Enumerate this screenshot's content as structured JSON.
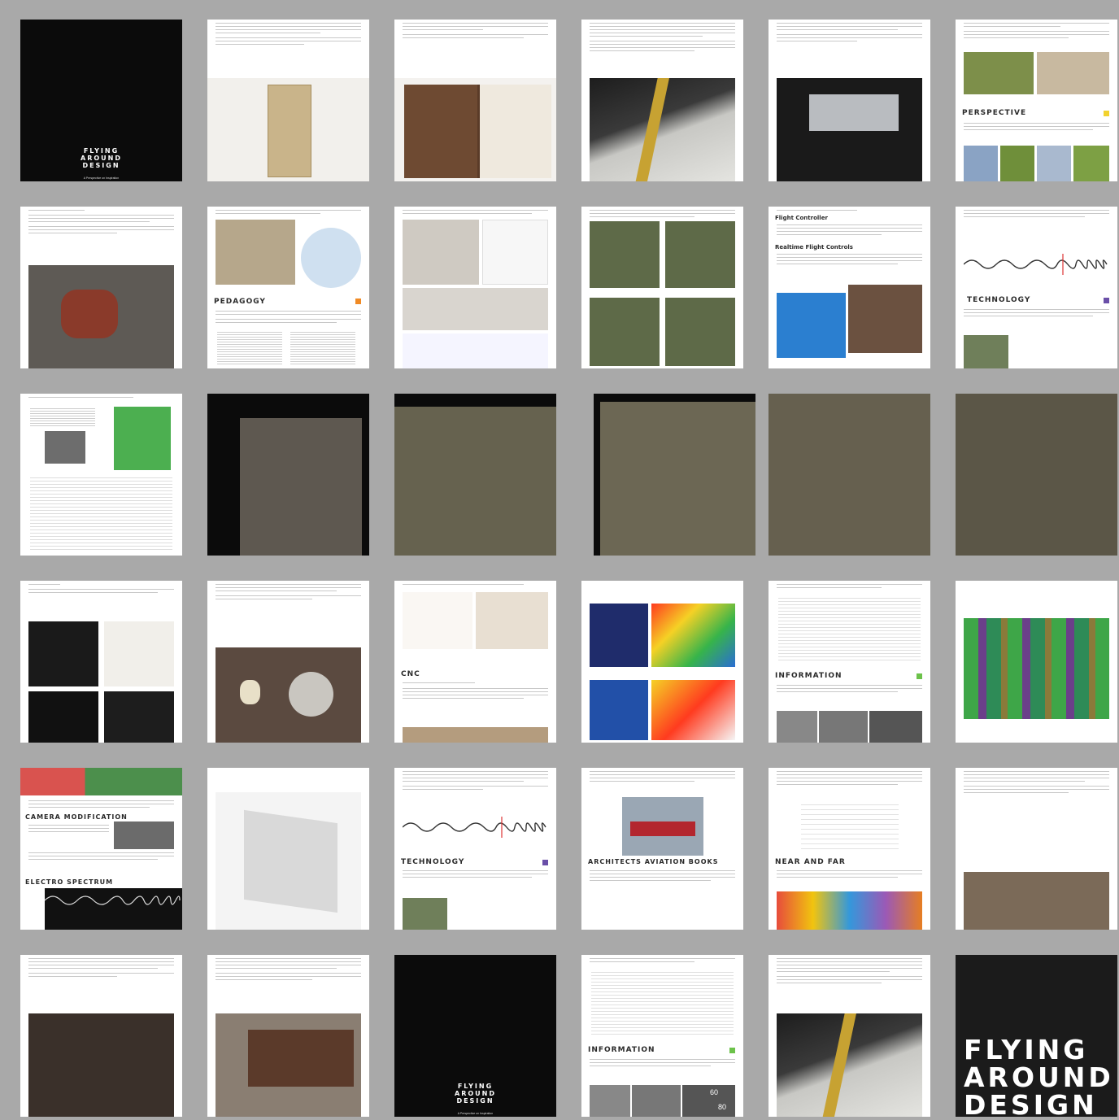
{
  "document": {
    "layout": "contact-sheet",
    "rows": 7,
    "columns": 6,
    "background": "#a9a9a9"
  },
  "cover": {
    "title_lines": [
      "FLYING",
      "AROUND",
      "DESIGN"
    ],
    "subtitle": "A Perspective on Inspiration"
  },
  "headings": {
    "perspective": "PERSPECTIVE",
    "pedagogy": "PEDAGOGY",
    "technology": "TECHNOLOGY",
    "flight_controller": "Flight Controller",
    "realtime_flight_controls": "Realtime Flight Controls",
    "cnc": "CNC",
    "information": "INFORMATION",
    "camera_modification": "CAMERA MODIFICATION",
    "electro_spectrum": "ELECTRO SPECTRUM",
    "architects_aviation_books": "ARCHITECTS AVIATION BOOKS",
    "near_and_far": "NEAR AND FAR"
  },
  "gauge_labels": {
    "primary": "60",
    "secondary": "80"
  },
  "colors": {
    "accent_yellow": "#f2d22e",
    "accent_orange": "#f08a24",
    "accent_purple": "#6a4fa8",
    "accent_green": "#6cc24a"
  }
}
